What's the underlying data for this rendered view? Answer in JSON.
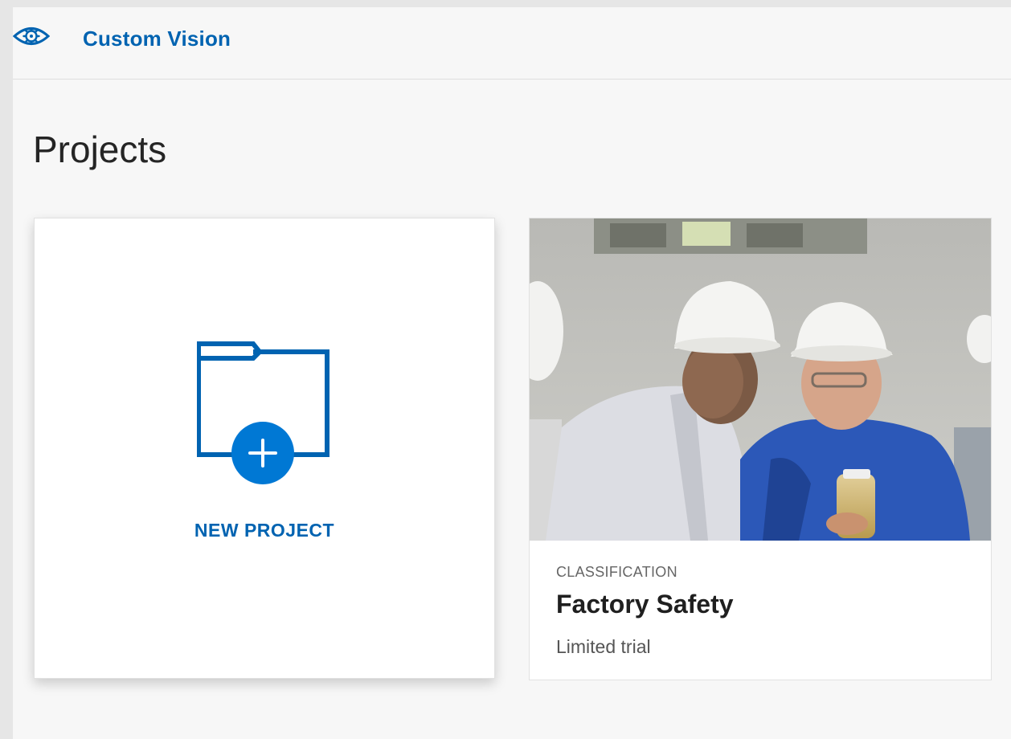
{
  "header": {
    "logo_icon": "eye-gear-icon",
    "brand": "Custom Vision"
  },
  "page": {
    "title": "Projects"
  },
  "new_project_card": {
    "icon": "folder-plus-icon",
    "label": "NEW PROJECT"
  },
  "projects": [
    {
      "type": "CLASSIFICATION",
      "name": "Factory Safety",
      "tier": "Limited trial",
      "thumbnail": "workers-in-hard-hats-photo"
    }
  ],
  "colors": {
    "accent": "#0063b1",
    "icon_blue": "#0078d4",
    "background": "#f7f7f7",
    "card": "#ffffff"
  }
}
